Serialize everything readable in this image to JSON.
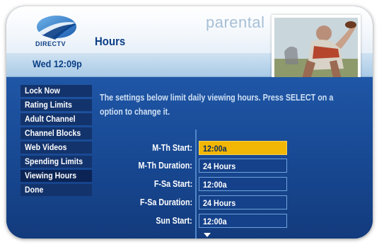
{
  "header": {
    "brand": "DIRECTV",
    "title": "Hours",
    "section": "parental",
    "clock": "Wed 12:09p"
  },
  "menu": {
    "items": [
      {
        "label": "Lock Now"
      },
      {
        "label": "Rating Limits"
      },
      {
        "label": "Adult Channel"
      },
      {
        "label": "Channel Blocks"
      },
      {
        "label": "Web Videos"
      },
      {
        "label": "Spending Limits"
      },
      {
        "label": "Viewing Hours"
      },
      {
        "label": "Done"
      }
    ]
  },
  "description": {
    "line1": "The settings below limit daily viewing hours. Press SELECT on a",
    "line2": "option to change it."
  },
  "settings": [
    {
      "label": "M-Th Start:",
      "value": "12:00a"
    },
    {
      "label": "M-Th Duration:",
      "value": "24 Hours"
    },
    {
      "label": "F-Sa Start:",
      "value": "12:00a"
    },
    {
      "label": "F-Sa Duration:",
      "value": "24 Hours"
    },
    {
      "label": "Sun Start:",
      "value": "12:00a"
    }
  ],
  "colors": {
    "selected": "#f2b705",
    "background": "#1a4a95",
    "menu_item": "#13336c"
  },
  "icons": {
    "logo": "directv-logo-icon",
    "scroll": "scroll-down-arrow-icon"
  }
}
